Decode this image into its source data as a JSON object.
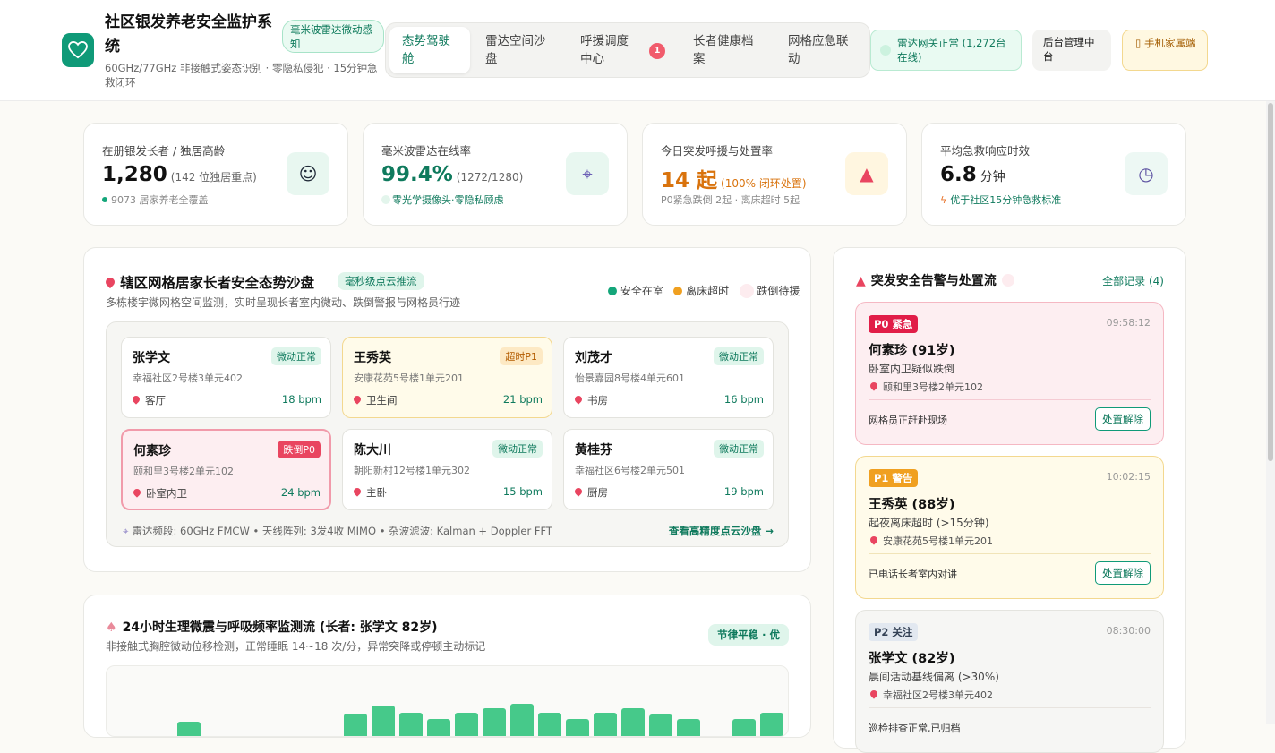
{
  "header": {
    "title": "社区银发养老安全监护系统",
    "badge": "毫米波雷达微动感知",
    "subtitle": "60GHz/77GHz 非接触式姿态识别 · 零隐私侵犯 · 15分钟急救闭环",
    "tabs": [
      {
        "label": "态势驾驶舱"
      },
      {
        "label": "雷达空间沙盘"
      },
      {
        "label": "呼援调度中心"
      },
      {
        "label": "长者健康档案"
      },
      {
        "label": "网格应急联动"
      }
    ],
    "tab_badge": "1",
    "gateway_status": "雷达网关正常 (1,272台在线)",
    "admin": "后台管理中台",
    "mobile": "手机家属端"
  },
  "stats": [
    {
      "label": "在册银发长者 / 独居高龄",
      "value": "1,280",
      "sub": "(142 位独居重点)",
      "note": "9073 居家养老全覆盖",
      "icon": "elder-icon",
      "color": "#111111"
    },
    {
      "label": "毫米波雷达在线率",
      "value": "99.4%",
      "sub": "(1272/1280)",
      "note": "零光学摄像头·零隐私顾虑",
      "icon": "radar-icon",
      "color": "#0f7a5d"
    },
    {
      "label": "今日突发呼援与处置率",
      "value": "14 起",
      "sub": "(100% 闭环处置)",
      "note": "P0紧急跌倒 2起 · 离床超时 5起",
      "icon": "siren-icon",
      "color": "#d9730d"
    },
    {
      "label": "平均急救响应时效",
      "value": "6.8",
      "sub": "分钟",
      "note": "优于社区15分钟急救标准",
      "icon": "stopwatch-icon",
      "color": "#111111"
    }
  ],
  "sandbox": {
    "title": "辖区网格居家长者安全态势沙盘",
    "badge": "毫秒级点云推流",
    "subtitle": "多栋楼宇微网格空间监测，实时呈现长者室内微动、跌倒警报与网格员行迹",
    "legend": [
      "安全在室",
      "离床超时",
      "跌倒待援"
    ],
    "elders": [
      {
        "name": "张学文",
        "status": "微动正常",
        "addr": "幸福社区2号楼3单元402",
        "room": "客厅",
        "bpm": "18 bpm"
      },
      {
        "name": "王秀英",
        "status": "超时P1",
        "addr": "安康花苑5号楼1单元201",
        "room": "卫生间",
        "bpm": "21 bpm"
      },
      {
        "name": "刘茂才",
        "status": "微动正常",
        "addr": "怡景嘉园8号楼4单元601",
        "room": "书房",
        "bpm": "16 bpm"
      },
      {
        "name": "何素珍",
        "status": "跌倒P0",
        "addr": "颐和里3号楼2单元102",
        "room": "卧室内卫",
        "bpm": "24 bpm"
      },
      {
        "name": "陈大川",
        "status": "微动正常",
        "addr": "朝阳新村12号楼1单元302",
        "room": "主卧",
        "bpm": "15 bpm"
      },
      {
        "name": "黄桂芬",
        "status": "微动正常",
        "addr": "幸福社区6号楼2单元501",
        "room": "厨房",
        "bpm": "19 bpm"
      }
    ],
    "footer": "雷达频段: 60GHz FMCW   •   天线阵列: 3发4收 MIMO   •   杂波滤波: Kalman + Doppler FFT",
    "link": "查看高精度点云沙盘 →"
  },
  "vitals": {
    "title": "24小时生理微震与呼吸频率监测流 (长者: 张学文 82岁)",
    "subtitle": "非接触式胸腔微动位移检测，正常睡眠 14~18 次/分，异常突降或停顿主动标记",
    "badge": "节律平稳 · 优",
    "bars": [
      0,
      0.15,
      0,
      0,
      0,
      0,
      0,
      0.55,
      0.9,
      0.6,
      0.3,
      0.6,
      0.8,
      1.0,
      0.6,
      0.3,
      0.6,
      0.8,
      0.5,
      0.3,
      0,
      0.3,
      0.6,
      0.55
    ]
  },
  "alerts": {
    "title": "突发安全告警与处置流",
    "all": "全部记录 (4)",
    "items": [
      {
        "level": "P0 紧急",
        "time": "09:58:12",
        "name": "何素珍 (91岁)",
        "desc": "卧室内卫疑似跌倒",
        "loc": "颐和里3号楼2单元102",
        "action": "网格员正赶赴现场",
        "button": "处置解除"
      },
      {
        "level": "P1 警告",
        "time": "10:02:15",
        "name": "王秀英 (88岁)",
        "desc": "起夜离床超时 (>15分钟)",
        "loc": "安康花苑5号楼1单元201",
        "action": "已电话长者室内对讲",
        "button": "处置解除"
      },
      {
        "level": "P2 关注",
        "time": "08:30:00",
        "name": "张学文 (82岁)",
        "desc": "晨间活动基线偏离 (>30%)",
        "loc": "幸福社区2号楼3单元402",
        "action": "巡检排查正常,已归档",
        "button": ""
      }
    ]
  }
}
